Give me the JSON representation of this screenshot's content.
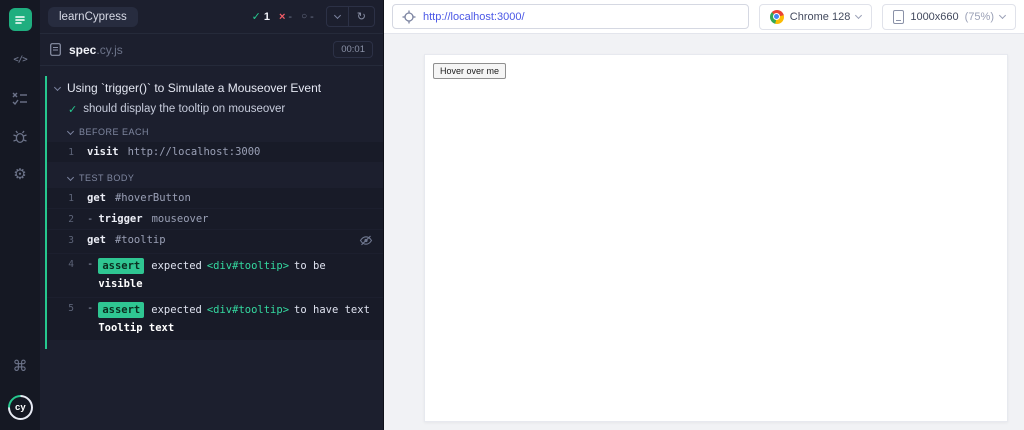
{
  "colors": {
    "accent_green": "#26c88f",
    "badge_green": "#2fc692",
    "fail_red": "#f25c68",
    "url_blue": "#4a57e6",
    "dark_bg": "#1c1f2e"
  },
  "icons": {
    "check": "✓",
    "cross": "×",
    "pending": "○",
    "refresh": "↻",
    "code": "</>",
    "settings": "⚙",
    "command": "⌘",
    "logo_text": "cy"
  },
  "reporter": {
    "project": "learnCypress",
    "stats": {
      "passed": "1",
      "failed": "-",
      "pending": "-"
    },
    "spec": {
      "name": "spec",
      "ext": ".cy.js",
      "duration": "00:01"
    },
    "suite_title": "Using `trigger()` to Simulate a Mouseover Event",
    "test_title": "should display the tooltip on mouseover",
    "before_each": {
      "label": "BEFORE EACH",
      "commands": [
        {
          "num": "1",
          "name": "visit",
          "arg": "http://localhost:3000"
        }
      ]
    },
    "test_body": {
      "label": "TEST BODY",
      "commands": [
        {
          "num": "1",
          "name": "get",
          "arg": "#hoverButton"
        },
        {
          "num": "2",
          "dash": "-",
          "name": "trigger",
          "arg": "mouseover"
        },
        {
          "num": "3",
          "name": "get",
          "arg": "#tooltip"
        },
        {
          "num": "4",
          "dash": "-",
          "badge": "assert",
          "pre": "expected",
          "target": "<div#tooltip>",
          "mid": "to be",
          "strong": "visible"
        },
        {
          "num": "5",
          "dash": "-",
          "badge": "assert",
          "pre": "expected",
          "target": "<div#tooltip>",
          "mid": "to have text",
          "strong": "Tooltip text"
        }
      ]
    }
  },
  "preview": {
    "url": "http://localhost:3000/",
    "browser": "Chrome 128",
    "viewport_size": "1000x660",
    "viewport_zoom": "(75%)",
    "page": {
      "hover_button": "Hover over me"
    }
  }
}
